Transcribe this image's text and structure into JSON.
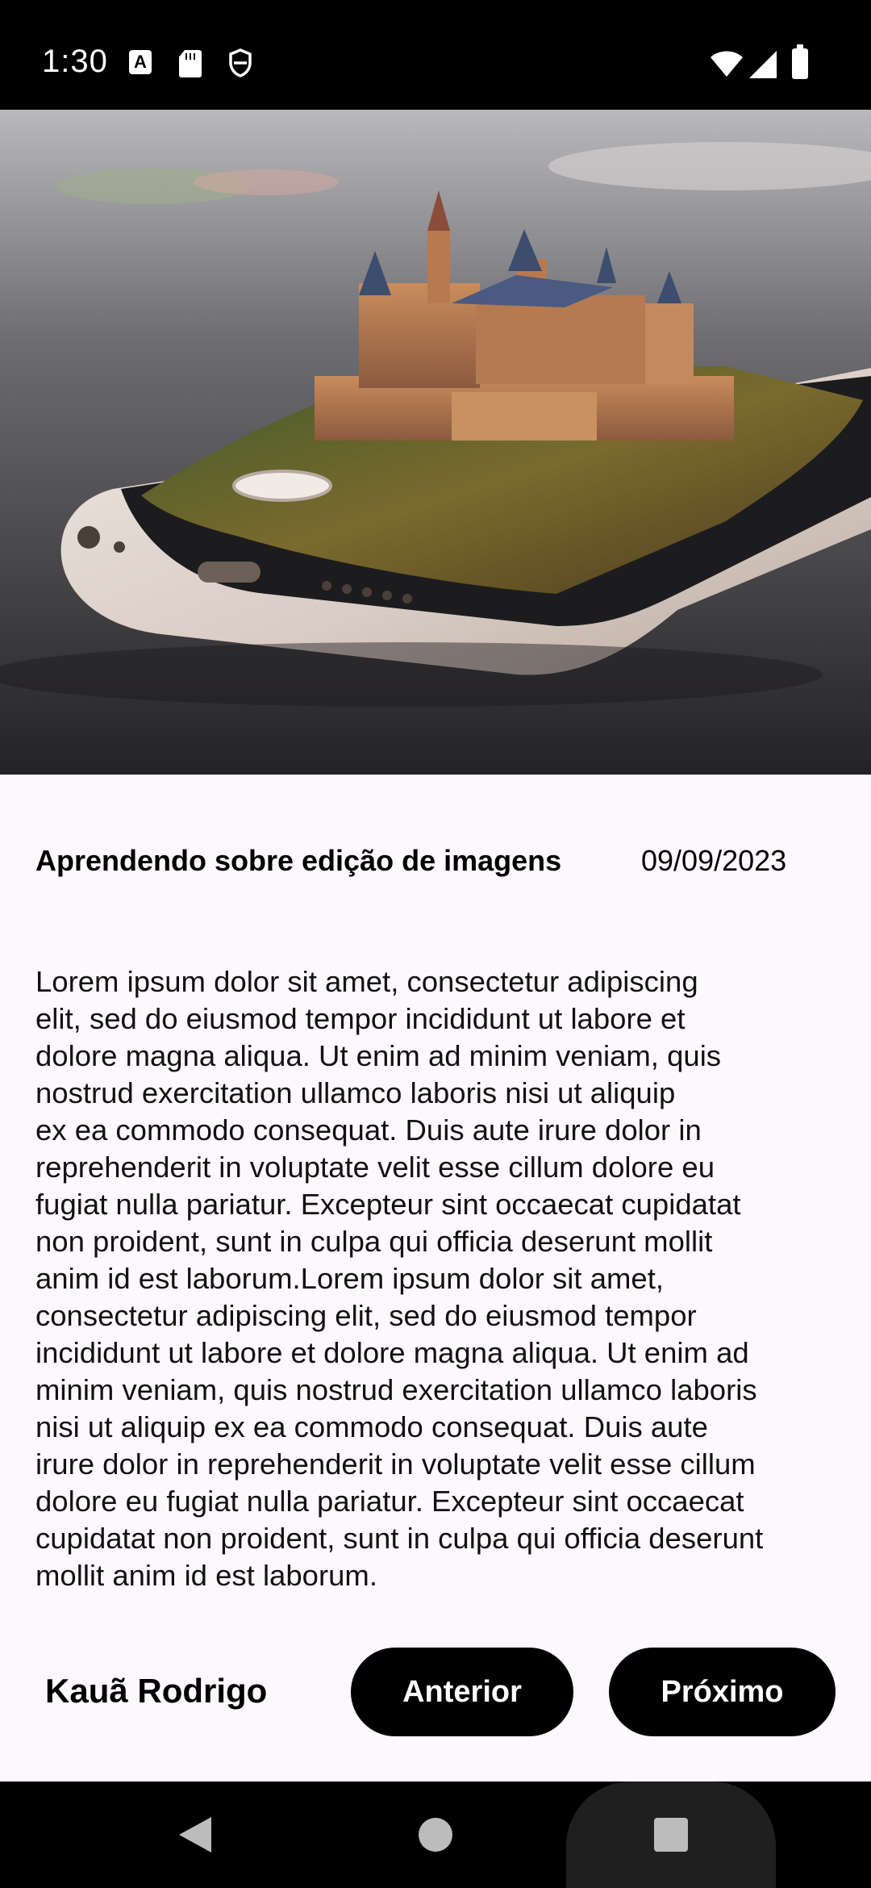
{
  "status_bar": {
    "time": "1:30",
    "icons": [
      "keyboard-a-icon",
      "sd-card-icon",
      "vpn-shield-icon",
      "wifi-icon",
      "cellular-icon",
      "battery-icon"
    ]
  },
  "hero": {
    "image_subject": "castle-on-phone-photo"
  },
  "post": {
    "title": "Aprendendo sobre edição de imagens",
    "date": "09/09/2023",
    "body_lines": [
      "Lorem ipsum dolor sit amet, consectetur adipiscing",
      "elit, sed do eiusmod tempor incididunt ut labore et",
      "dolore magna aliqua. Ut enim ad minim veniam, quis",
      "nostrud exercitation ullamco laboris nisi ut aliquip",
      "ex ea commodo consequat. Duis aute irure dolor in",
      "reprehenderit in voluptate velit esse cillum dolore eu",
      "fugiat nulla pariatur. Excepteur sint occaecat cupidatat",
      "non proident, sunt in culpa qui officia deserunt mollit",
      "anim id est laborum.Lorem ipsum dolor sit amet,",
      "consectetur adipiscing elit, sed do eiusmod tempor",
      "incididunt ut labore et dolore magna aliqua. Ut enim ad",
      "minim veniam, quis nostrud exercitation ullamco laboris",
      "nisi ut aliquip ex ea commodo consequat. Duis aute",
      "irure dolor in reprehenderit in voluptate velit esse cillum",
      "dolore eu fugiat nulla pariatur. Excepteur sint occaecat",
      "cupidatat non proident, sunt in culpa qui officia deserunt",
      "mollit anim id est laborum."
    ],
    "author": "Kauã Rodrigo"
  },
  "buttons": {
    "previous": "Anterior",
    "next": "Próximo"
  },
  "colors": {
    "background": "#fdf8fd",
    "button_bg": "#000000",
    "button_text": "#ffffff"
  }
}
